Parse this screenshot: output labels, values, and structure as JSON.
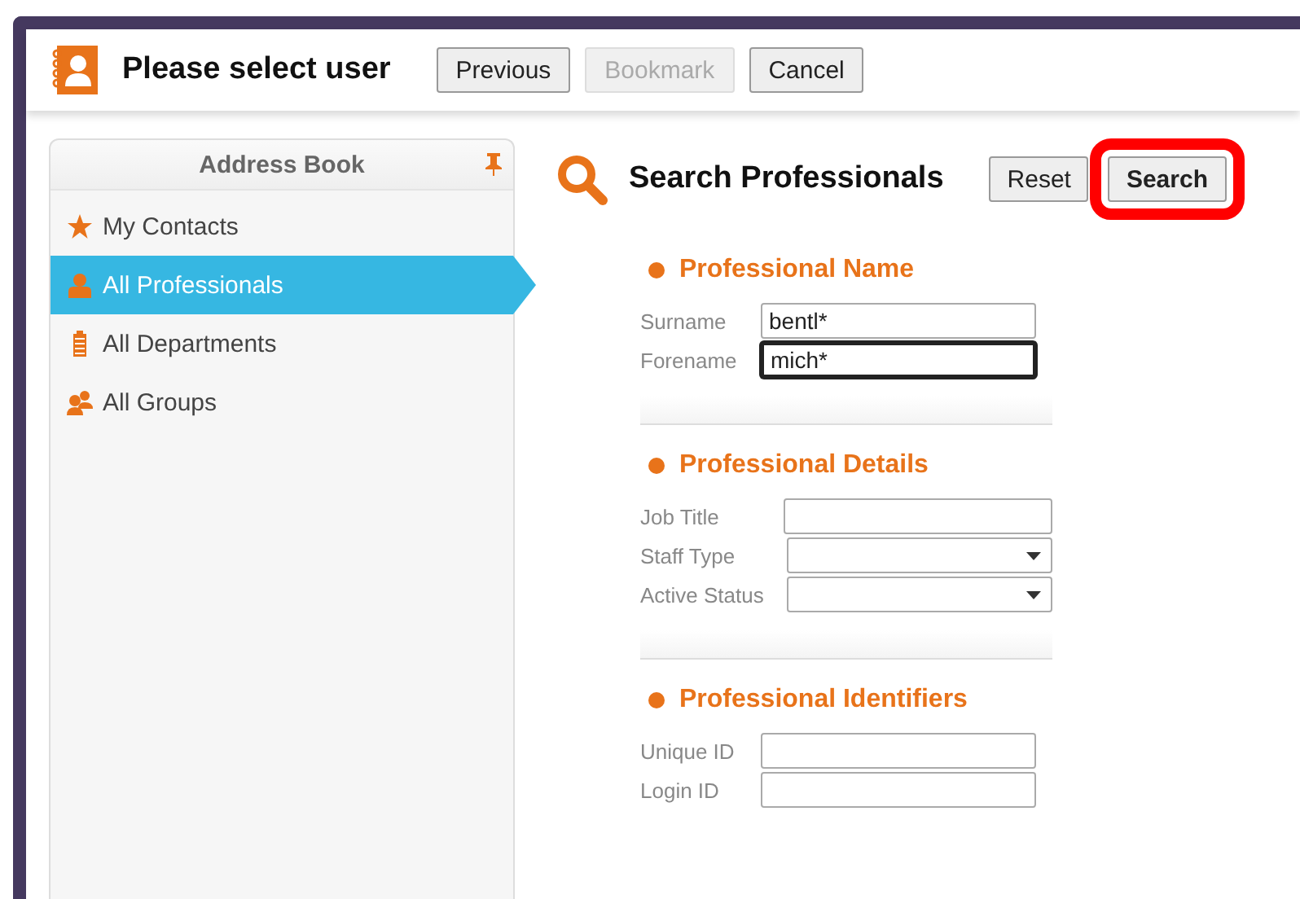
{
  "window": {
    "title": "Please select user"
  },
  "header_buttons": [
    {
      "label": "Previous",
      "disabled": false
    },
    {
      "label": "Bookmark",
      "disabled": true
    },
    {
      "label": "Cancel",
      "disabled": false
    }
  ],
  "sidebar": {
    "title": "Address Book",
    "items": [
      {
        "label": "My Contacts",
        "kind": "star",
        "selected": false
      },
      {
        "label": "All Professionals",
        "kind": "person",
        "selected": true
      },
      {
        "label": "All Departments",
        "kind": "building",
        "selected": false
      },
      {
        "label": "All Groups",
        "kind": "group",
        "selected": false
      }
    ]
  },
  "search": {
    "title": "Search Professionals",
    "buttons": [
      {
        "label": "Reset",
        "highlighted": false
      },
      {
        "label": "Search",
        "highlighted": true
      }
    ],
    "sections": [
      {
        "title": "Professional Name",
        "fields": [
          {
            "label": "Surname",
            "kind": "text",
            "value": "bentl*",
            "focused": false
          },
          {
            "label": "Forename",
            "kind": "text",
            "value": "mich*",
            "focused": true
          }
        ]
      },
      {
        "title": "Professional Details",
        "fields": [
          {
            "label": "Job Title",
            "kind": "text",
            "focused": false
          },
          {
            "label": "Staff Type",
            "kind": "select",
            "focused": false
          },
          {
            "label": "Active Status",
            "kind": "select",
            "focused": false
          }
        ]
      },
      {
        "title": "Professional Identifiers",
        "fields": [
          {
            "label": "Unique ID",
            "kind": "text",
            "focused": false
          },
          {
            "label": "Login ID",
            "kind": "text",
            "focused": false
          }
        ]
      }
    ]
  }
}
